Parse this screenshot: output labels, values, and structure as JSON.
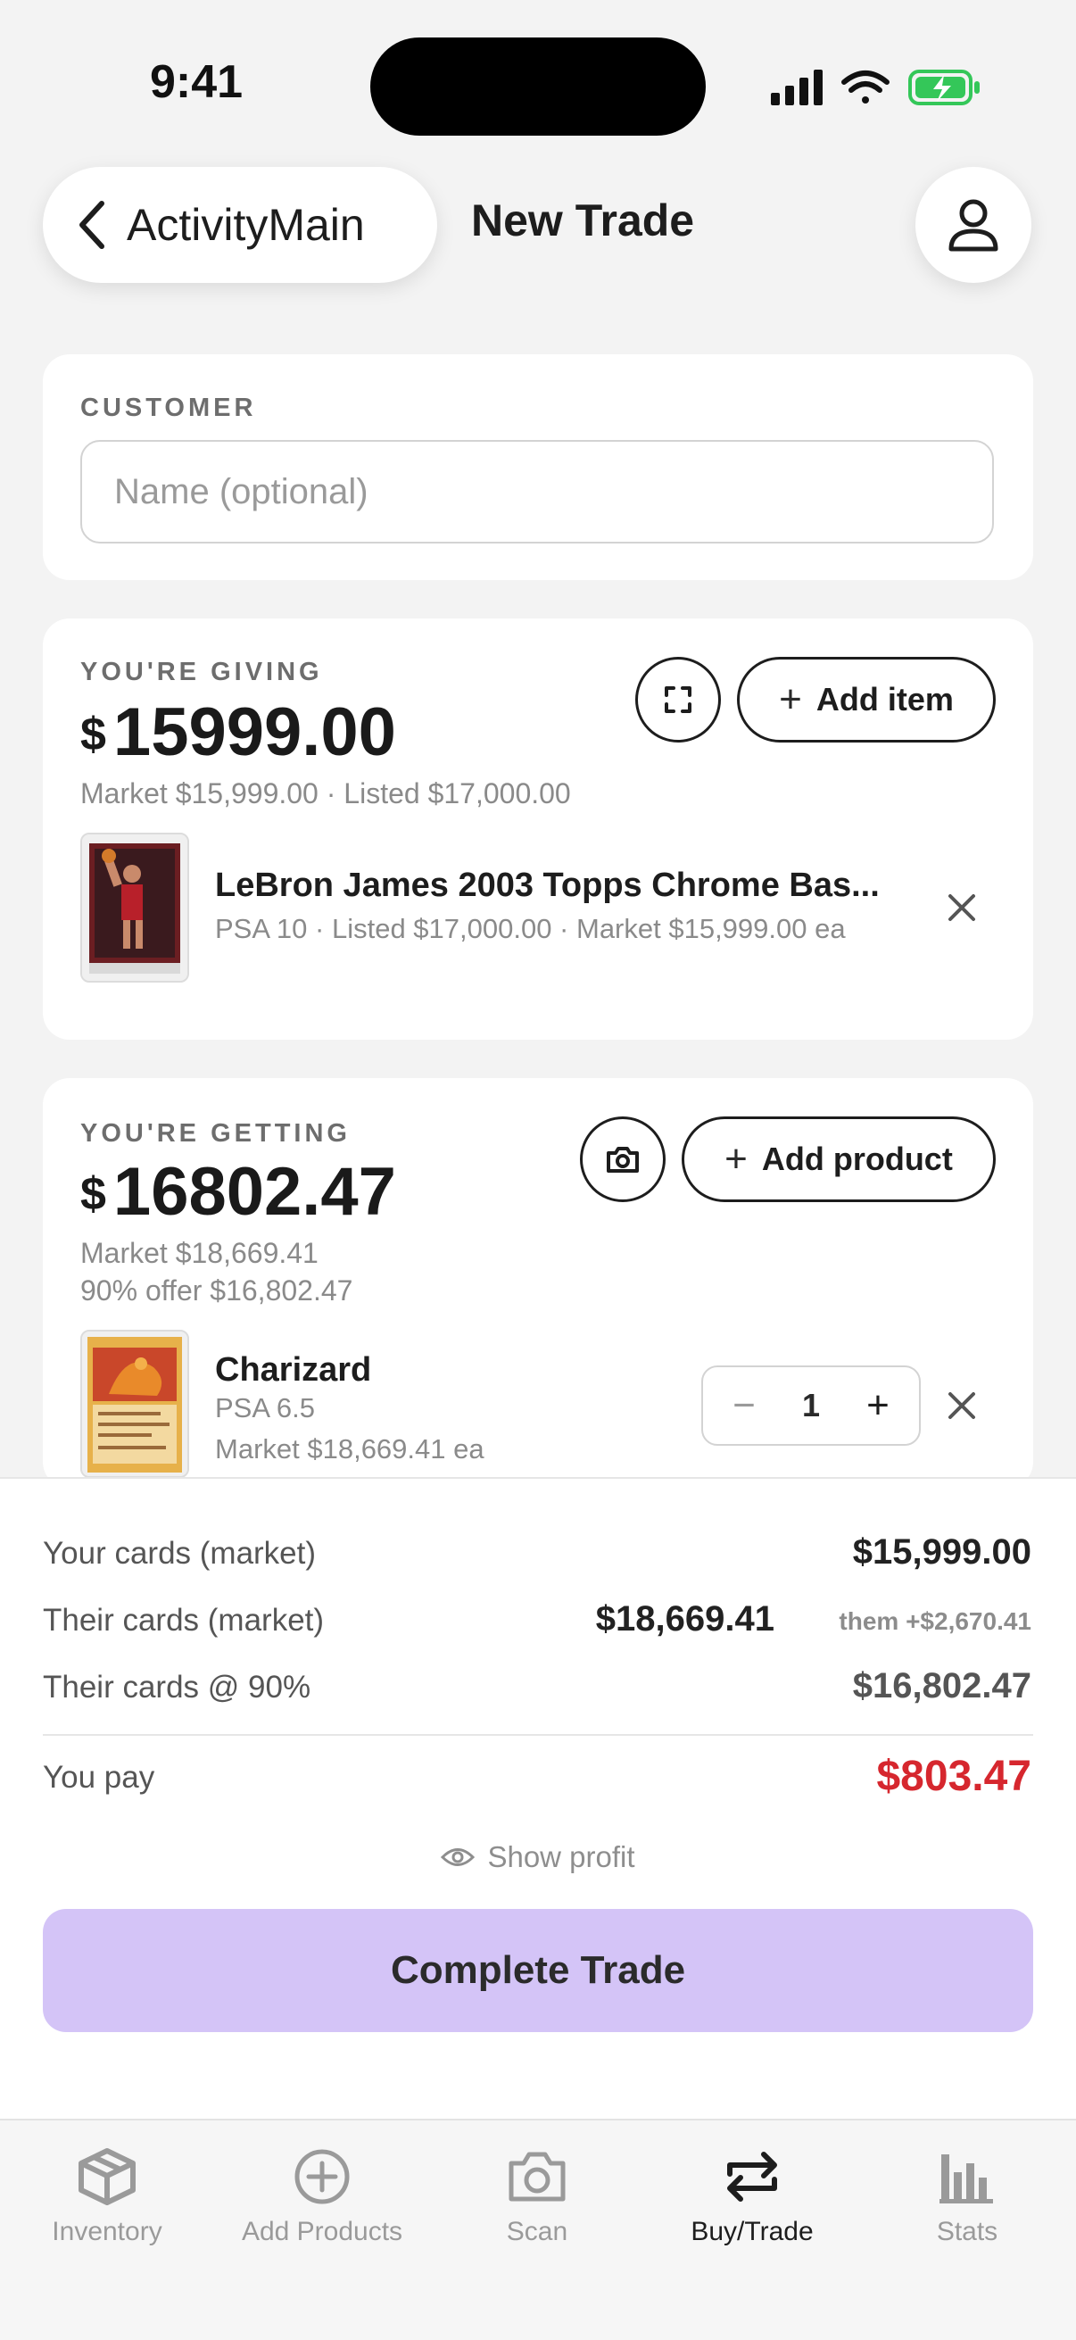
{
  "status_bar": {
    "time": "9:41"
  },
  "header": {
    "back_label": "ActivityMain",
    "title": "New Trade"
  },
  "customer": {
    "label": "CUSTOMER",
    "placeholder": "Name (optional)",
    "value": ""
  },
  "giving": {
    "label": "YOU'RE GIVING",
    "currency": "$",
    "total": "15999.00",
    "summary_line": "Market $15,999.00 · Listed $17,000.00",
    "add_button": "Add item",
    "items": [
      {
        "title": "LeBron James 2003 Topps Chrome Bas...",
        "subtitle": "PSA 10 · Listed $17,000.00 · Market $15,999.00 ea"
      }
    ]
  },
  "getting": {
    "label": "YOU'RE GETTING",
    "currency": "$",
    "total": "16802.47",
    "market_line": "Market $18,669.41",
    "offer_line": "90% offer $16,802.47",
    "add_button": "Add product",
    "items": [
      {
        "title": "Charizard",
        "grade": "PSA 6.5",
        "market": "Market $18,669.41 ea",
        "quantity": "1"
      }
    ]
  },
  "summary": {
    "your_cards_label": "Your cards (market)",
    "your_cards_value": "$15,999.00",
    "their_cards_label": "Their cards (market)",
    "their_cards_value": "$18,669.41",
    "their_diff": "them +$2,670.41",
    "their_pct_label": "Their cards @ 90%",
    "their_pct_value": "$16,802.47",
    "you_pay_label": "You pay",
    "you_pay_value": "$803.47",
    "show_profit": "Show profit",
    "complete_button": "Complete Trade"
  },
  "tabs": [
    {
      "label": "Inventory",
      "icon": "cube-icon"
    },
    {
      "label": "Add Products",
      "icon": "plus-circle-icon"
    },
    {
      "label": "Scan",
      "icon": "camera-icon"
    },
    {
      "label": "Buy/Trade",
      "icon": "swap-icon",
      "active": true
    },
    {
      "label": "Stats",
      "icon": "bar-chart-icon"
    }
  ],
  "colors": {
    "accent_button": "#d4c4f7",
    "pay_red": "#d6272e",
    "background": "#f3f3f3",
    "battery_green": "#34c759"
  }
}
